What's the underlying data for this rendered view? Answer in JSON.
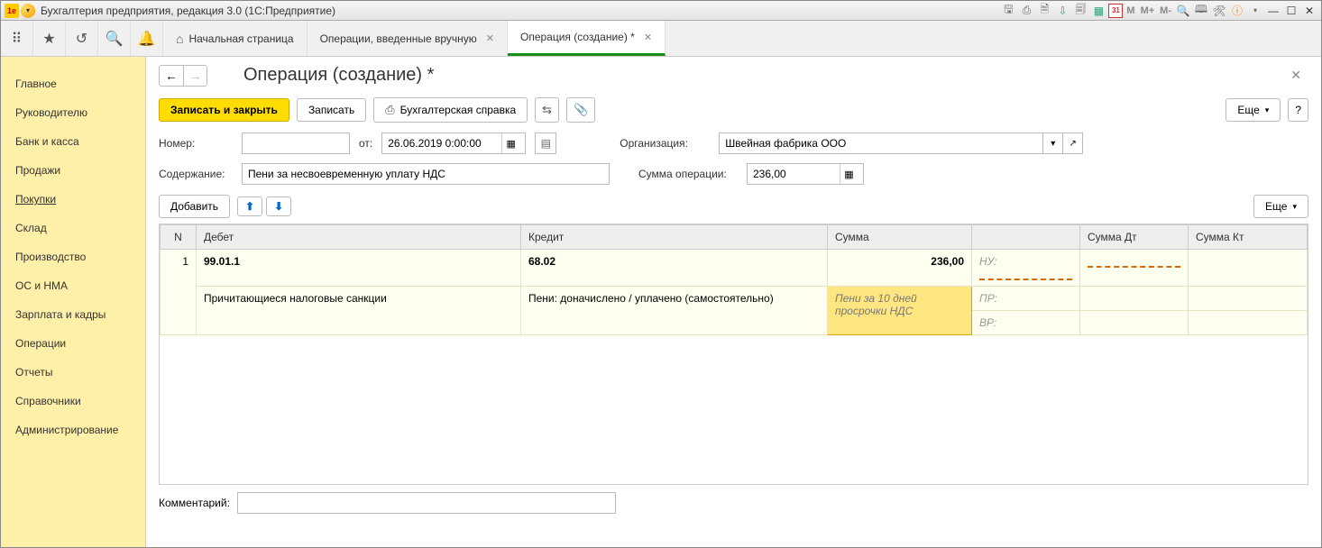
{
  "titlebar": {
    "logo_text": "1e",
    "title": "Бухгалтерия предприятия, редакция 3.0  (1С:Предприятие)",
    "cal": "31",
    "m": "M",
    "mp": "M+",
    "mm": "M-"
  },
  "tabs": {
    "home": "Начальная страница",
    "t1": "Операции, введенные вручную",
    "t2": "Операция (создание) *"
  },
  "sidebar": {
    "items": [
      "Главное",
      "Руководителю",
      "Банк и касса",
      "Продажи",
      "Покупки",
      "Склад",
      "Производство",
      "ОС и НМА",
      "Зарплата и кадры",
      "Операции",
      "Отчеты",
      "Справочники",
      "Администрирование"
    ]
  },
  "page": {
    "title": "Операция (создание) *",
    "save_close": "Записать и закрыть",
    "save": "Записать",
    "print_ref": "Бухгалтерская справка",
    "more": "Еще",
    "help": "?",
    "number_lbl": "Номер:",
    "number": "",
    "from_lbl": "от:",
    "date": "26.06.2019  0:00:00",
    "org_lbl": "Организация:",
    "org": "Швейная фабрика ООО",
    "content_lbl": "Содержание:",
    "content": "Пени за несвоевременную уплату НДС",
    "sumop_lbl": "Сумма операции:",
    "sumop": "236,00",
    "add": "Добавить",
    "comment_lbl": "Комментарий:",
    "comment": ""
  },
  "table": {
    "headers": {
      "n": "N",
      "debit": "Дебет",
      "credit": "Кредит",
      "sum": "Сумма",
      "sdt": "Сумма Дт",
      "skt": "Сумма Кт"
    },
    "rows": [
      {
        "n": "1",
        "deb_acc": "99.01.1",
        "deb_sub": "Причитающиеся налоговые санкции",
        "kred_acc": "68.02",
        "kred_sub": "Пени: доначислено / уплачено (самостоятельно)",
        "sum": "236,00",
        "sum_note": "Пени за 10 дней просрочки НДС",
        "nu": "НУ:",
        "pr": "ПР:",
        "vr": "ВР:"
      }
    ]
  }
}
